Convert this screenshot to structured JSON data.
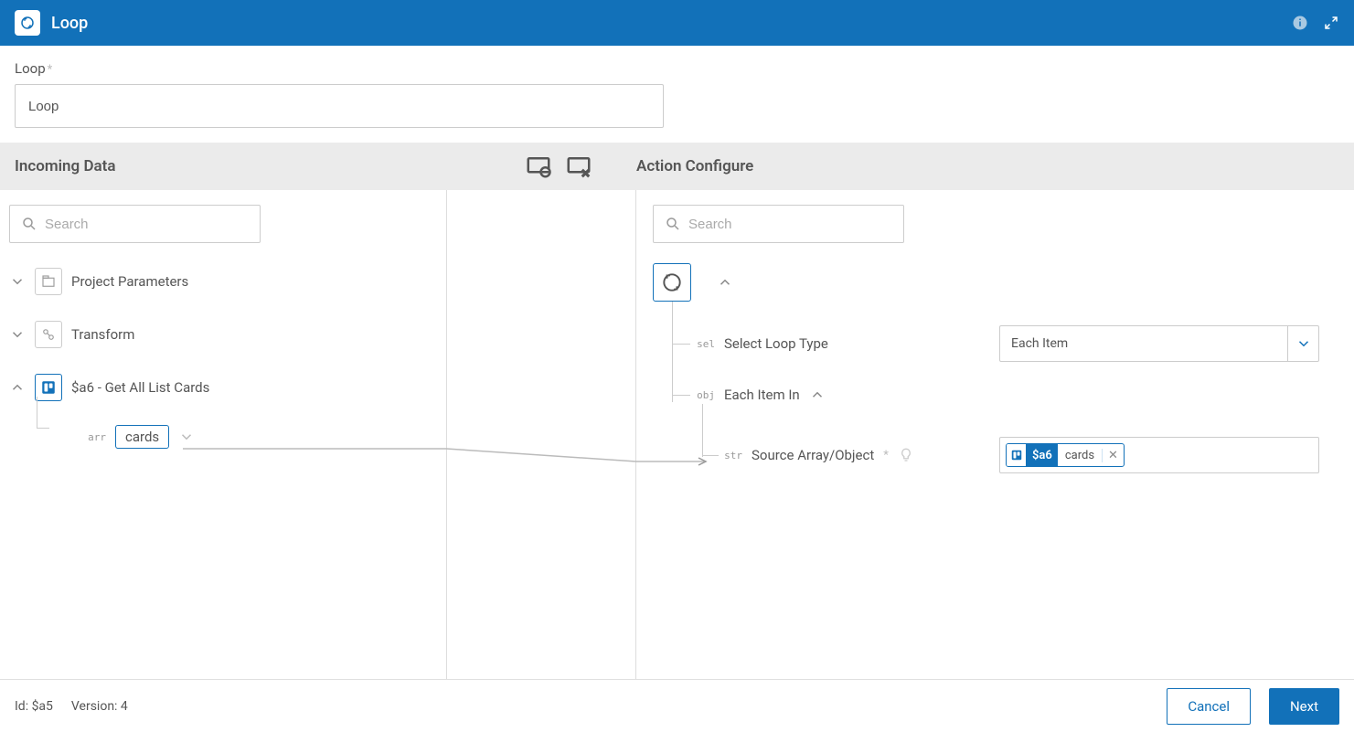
{
  "header": {
    "title": "Loop"
  },
  "loop_field": {
    "label": "Loop",
    "value": "Loop"
  },
  "sections": {
    "incoming_title": "Incoming Data",
    "action_title": "Action Configure"
  },
  "search": {
    "placeholder_left": "Search",
    "placeholder_right": "Search"
  },
  "incoming_tree": {
    "project_parameters": "Project Parameters",
    "transform": "Transform",
    "a6_node": "$a6 - Get All List Cards",
    "cards_field_type": "arr",
    "cards_field_label": "cards"
  },
  "action_config": {
    "select_loop_type_badge": "sel",
    "select_loop_type_label": "Select Loop Type",
    "select_value": "Each Item",
    "each_item_in_badge": "obj",
    "each_item_in_label": "Each Item In",
    "source_badge": "str",
    "source_label": "Source Array/Object",
    "token_id": "$a6",
    "token_field": "cards"
  },
  "footer": {
    "id_label": "Id: $a5",
    "version_label": "Version: 4",
    "cancel": "Cancel",
    "next": "Next"
  }
}
